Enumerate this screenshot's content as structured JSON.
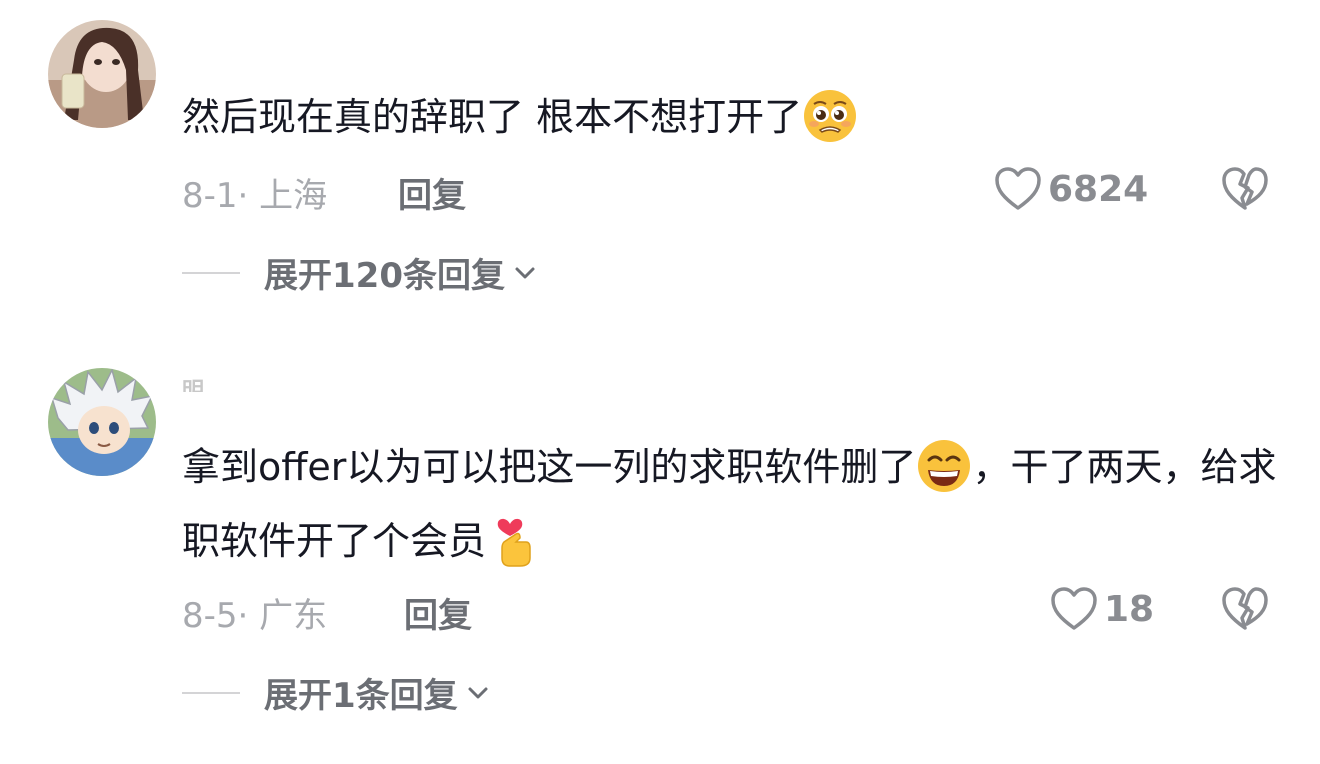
{
  "comments": [
    {
      "username": "",
      "text": "然后现在真的辞职了 根本不想打开了",
      "emoji": "pleading-face-icon",
      "date": "8-1·",
      "location": "上海",
      "reply_label": "回复",
      "like_count": "6824",
      "expand_label": "展开120条回复"
    },
    {
      "username": "明",
      "text_part1": "拿到offer以为可以把这一列的求职软件删了",
      "text_part2": "，干了两天，给求职软件开了个会员",
      "emoji1": "grinning-squint-face-icon",
      "emoji2": "finger-heart-icon",
      "date": "8-5·",
      "location": "广东",
      "reply_label": "回复",
      "like_count": "18",
      "expand_label": "展开1条回复"
    }
  ],
  "colors": {
    "text": "#161823",
    "meta": "#a7a9ae",
    "secondary": "#6b6e74"
  }
}
